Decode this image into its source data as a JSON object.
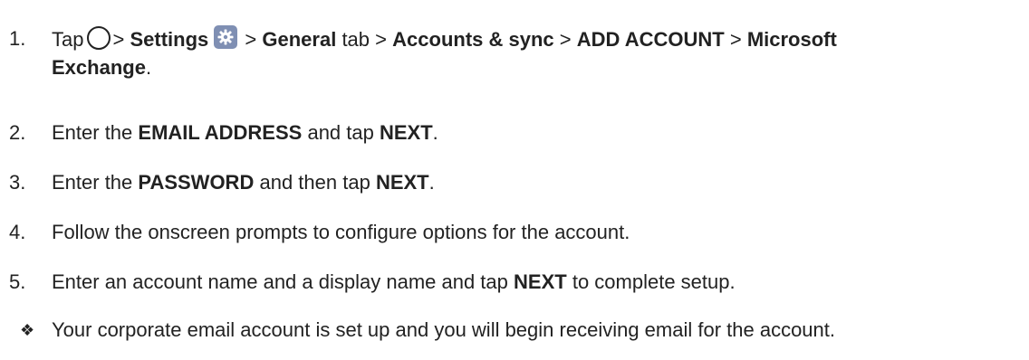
{
  "steps": [
    {
      "number": "1.",
      "tap": "Tap",
      "sep1": ">",
      "settings": "Settings",
      "sep2": ">",
      "general": "General",
      "tab": "tab",
      "sep3": ">",
      "accounts_sync": "Accounts & sync",
      "sep4": ">",
      "add_account": "ADD ACCOUNT",
      "sep5": ">",
      "microsoft": "Microsoft",
      "exchange": "Exchange",
      "period": "."
    },
    {
      "number": "2.",
      "pre": "Enter the",
      "bold1": "EMAIL ADDRESS",
      "mid": "and tap",
      "bold2": "NEXT",
      "post": "."
    },
    {
      "number": "3.",
      "pre": "Enter the",
      "bold1": "PASSWORD",
      "mid": "and then tap",
      "bold2": "NEXT",
      "post": "."
    },
    {
      "number": "4.",
      "text": "Follow the onscreen prompts to configure options for the account."
    },
    {
      "number": "5.",
      "pre": "Enter an account name and a display name and tap",
      "bold1": "NEXT",
      "post": "to complete setup."
    }
  ],
  "result": {
    "bullet": "❖",
    "text": "Your corporate email account is set up and you will begin receiving email for the account."
  },
  "icons": {
    "home": "home-circle-icon",
    "settings": "settings-gear-icon",
    "settings_bg": "#7f8fb3"
  }
}
